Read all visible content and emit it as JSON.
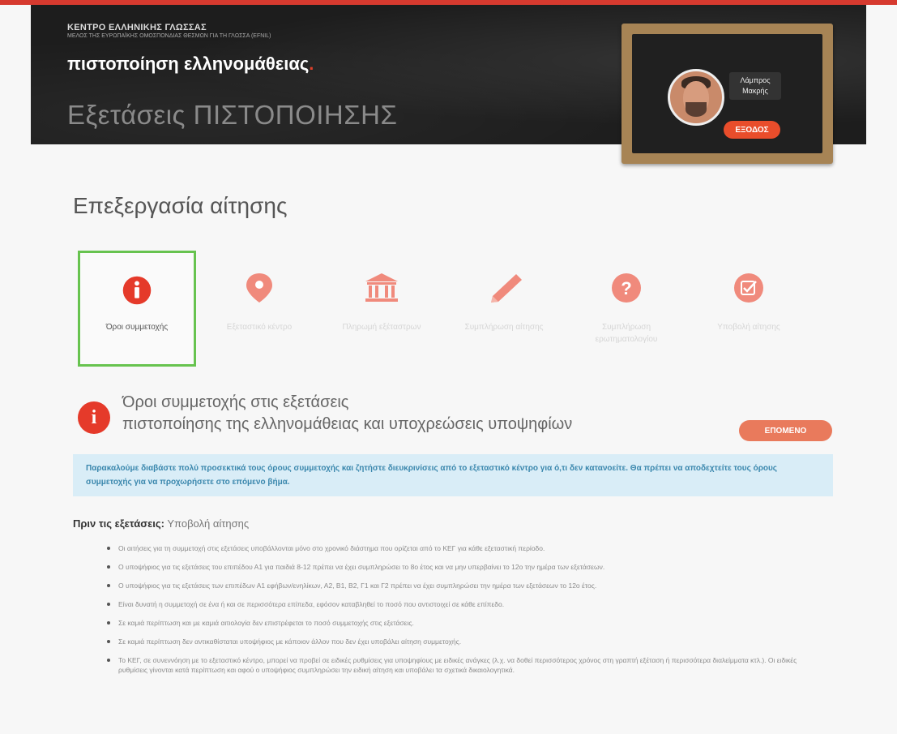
{
  "header": {
    "org_name": "ΚΕΝΤΡΟ ΕΛΛΗΝΙΚΗΣ ΓΛΩΣΣΑΣ",
    "org_subtitle": "ΜΕΛΟΣ ΤΗΣ ΕΥΡΩΠΑΪΚΗΣ ΟΜΟΣΠΟΝΔΙΑΣ ΘΕΣΜΩΝ ΓΙΑ ΤΗ ΓΛΩΣΣΑ (EFNIL)",
    "site_title": "πιστοποίηση ελληνομάθειας",
    "site_title_dot": ".",
    "exam_title": "Εξετάσεις ΠΙΣΤΟΠΟΙΗΣΗΣ"
  },
  "user": {
    "name_line1": "Λάμπρος",
    "name_line2": "Μακρής",
    "login_label": "ΕΞΟΔΟΣ"
  },
  "page": {
    "title": "Επεξεργασία αίτησης"
  },
  "steps": [
    {
      "label": "Όροι συμμετοχής",
      "icon": "info-circle-icon",
      "active": true
    },
    {
      "label": "Εξεταστικό κέντρο",
      "icon": "map-marker-icon",
      "active": false
    },
    {
      "label": "Πληρωμή εξέταστρων",
      "icon": "bank-icon",
      "active": false
    },
    {
      "label": "Συμπλήρωση αίτησης",
      "icon": "pencil-icon",
      "active": false
    },
    {
      "label": "Συμπλήρωση ερωτηματολογίου",
      "icon": "question-circle-icon",
      "active": false
    },
    {
      "label": "Υποβολή αίτησης",
      "icon": "checkbox-icon",
      "active": false
    }
  ],
  "terms": {
    "title_line1": "Όροι συμμετοχής στις εξετάσεις",
    "title_line2": "πιστοποίησης της ελληνομάθειας και υποχρεώσεις υποψηφίων",
    "next_label": "ΕΠΟΜΕΝΟ",
    "info_text": "Παρακαλούμε διαβάστε πολύ προσεκτικά τους όρους συμμετοχής και ζητήστε διευκρινίσεις από το εξεταστικό κέντρο για ό,τι δεν κατανοείτε. Θα πρέπει να αποδεχτείτε τους όρους συμμετοχής για να προχωρήσετε στο επόμενο βήμα.",
    "before_bold": "Πριν τις εξετάσεις:",
    "before_rest": "Υποβολή αίτησης",
    "rules": [
      "Οι αιτήσεις για τη συμμετοχή στις εξετάσεις υποβάλλονται μόνο στο χρονικό διάστημα που ορίζεται από το ΚΕΓ για κάθε εξεταστική περίοδο.",
      "Ο υποψήφιος για τις εξετάσεις του επιπέδου Α1 για παιδιά 8-12 πρέπει να έχει συμπληρώσει το 8ο έτος και να μην υπερβαίνει το 12ο την ημέρα των εξετάσεων.",
      "Ο υποψήφιος για τις εξετάσεις των επιπέδων Α1 εφήβων/ενηλίκων, Α2, Β1, Β2, Γ1 και Γ2 πρέπει να έχει συμπληρώσει την ημέρα των εξετάσεων το 12ο έτος.",
      "Είναι δυνατή η συμμετοχή σε ένα ή και σε περισσότερα επίπεδα, εφόσον καταβληθεί το ποσό που αντιστοιχεί σε κάθε επίπεδο.",
      "Σε καμιά περίπτωση και με καμιά αιτιολογία δεν επιστρέφεται το ποσό συμμετοχής στις εξετάσεις.",
      "Σε καμιά περίπτωση δεν αντικαθίσταται υποψήφιος με κάποιον άλλον που δεν έχει υποβάλει αίτηση συμμετοχής.",
      "Το ΚΕΓ, σε συνεννόηση με το εξεταστικό κέντρο, μπορεί να προβεί σε ειδικές ρυθμίσεις για υποψηφίους με ειδικές ανάγκες (λ.χ. να δοθεί περισσότερος χρόνος στη γραπτή εξέταση ή περισσότερα διαλείμματα κτλ.). Οι ειδικές ρυθμίσεις γίνονται κατά περίπτωση και αφού ο υποψήφιος συμπληρώσει την ειδική αίτηση και υποβάλει τα σχετικά δικαιολογητικά."
    ]
  },
  "colors": {
    "accent": "#e53a2a",
    "active_border": "#67c34f",
    "info_bg": "#d9edf7",
    "info_text": "#3a87ad"
  }
}
